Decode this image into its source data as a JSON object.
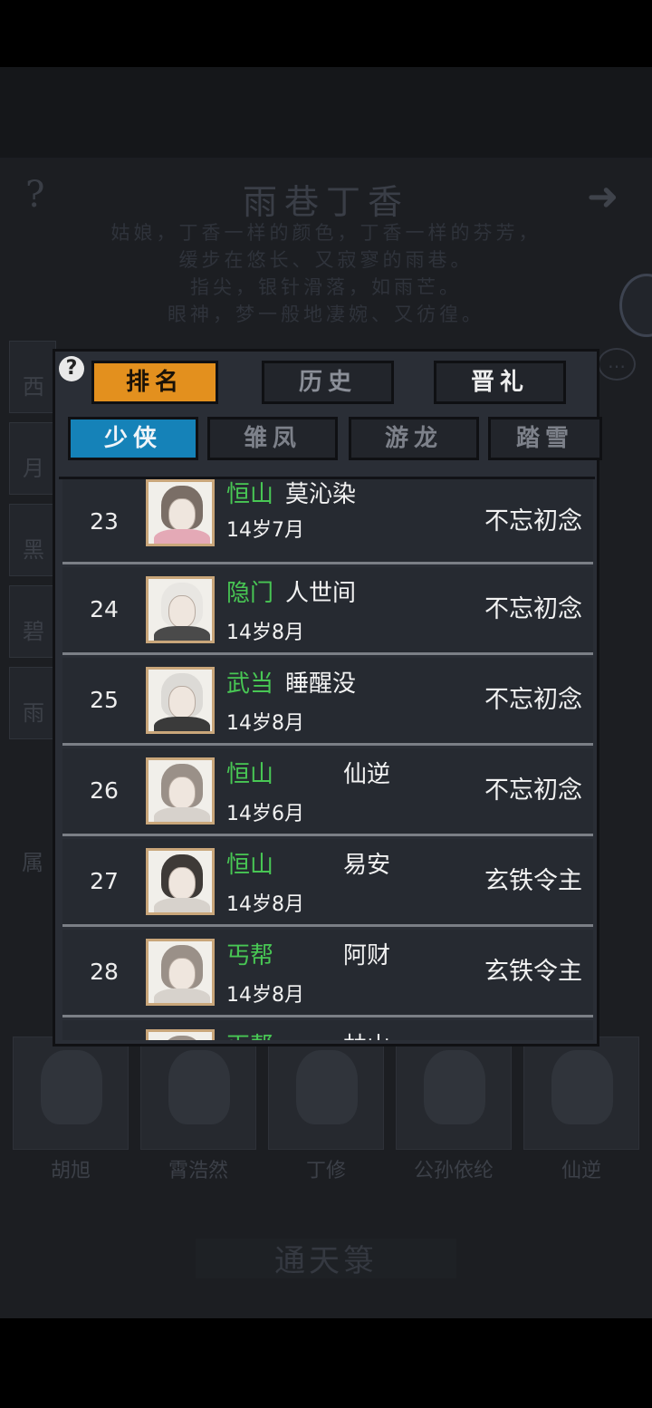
{
  "background": {
    "help_glyph": "?",
    "arrow_glyph": "➜",
    "title": "雨巷丁香",
    "poem": [
      "姑娘，丁香一样的颜色，丁香一样的芬芳，",
      "缓步在悠长、又寂寥的雨巷。",
      "指尖，银针滑落，如雨芒。",
      "眼神，梦一般地凄婉、又彷徨。"
    ],
    "side_tabs": [
      "西",
      "月",
      "黑",
      "碧",
      "雨"
    ],
    "attr_label": "属",
    "bubble_glyph": "…",
    "portrait_names": [
      "胡旭",
      "霄浩然",
      "丁修",
      "公孙依纶",
      "仙逆"
    ],
    "bottom_button": "通天箓"
  },
  "popup": {
    "help_label": "?",
    "main_tabs": [
      {
        "label": "排名",
        "active": true
      },
      {
        "label": "历史",
        "active": false
      },
      {
        "label": "晋礼",
        "active": false
      }
    ],
    "sub_tabs": [
      {
        "label": "少侠",
        "active": true
      },
      {
        "label": "雏凤",
        "active": false
      },
      {
        "label": "游龙",
        "active": false
      },
      {
        "label": "踏雪",
        "active": false
      }
    ],
    "rows": [
      {
        "rank": "23",
        "sect": "恒山",
        "name": "莫沁染",
        "age": "14岁7月",
        "title": "不忘初念"
      },
      {
        "rank": "24",
        "sect": "隐门",
        "name": "人世间",
        "age": "14岁8月",
        "title": "不忘初念"
      },
      {
        "rank": "25",
        "sect": "武当",
        "name": "睡醒没",
        "age": "14岁8月",
        "title": "不忘初念"
      },
      {
        "rank": "26",
        "sect": "恒山",
        "name": "仙逆",
        "age": "14岁6月",
        "title": "不忘初念"
      },
      {
        "rank": "27",
        "sect": "恒山",
        "name": "易安",
        "age": "14岁8月",
        "title": "玄铁令主"
      },
      {
        "rank": "28",
        "sect": "丐帮",
        "name": "阿财",
        "age": "14岁8月",
        "title": "玄铁令主"
      },
      {
        "rank": "",
        "sect": "丐帮",
        "name": "林山",
        "age": "",
        "title": ""
      }
    ]
  },
  "colors": {
    "active_main_tab": "#e3901e",
    "active_sub_tab": "#1582b8",
    "sect_green": "#48c754",
    "avatar_border": "#c9a67a"
  }
}
